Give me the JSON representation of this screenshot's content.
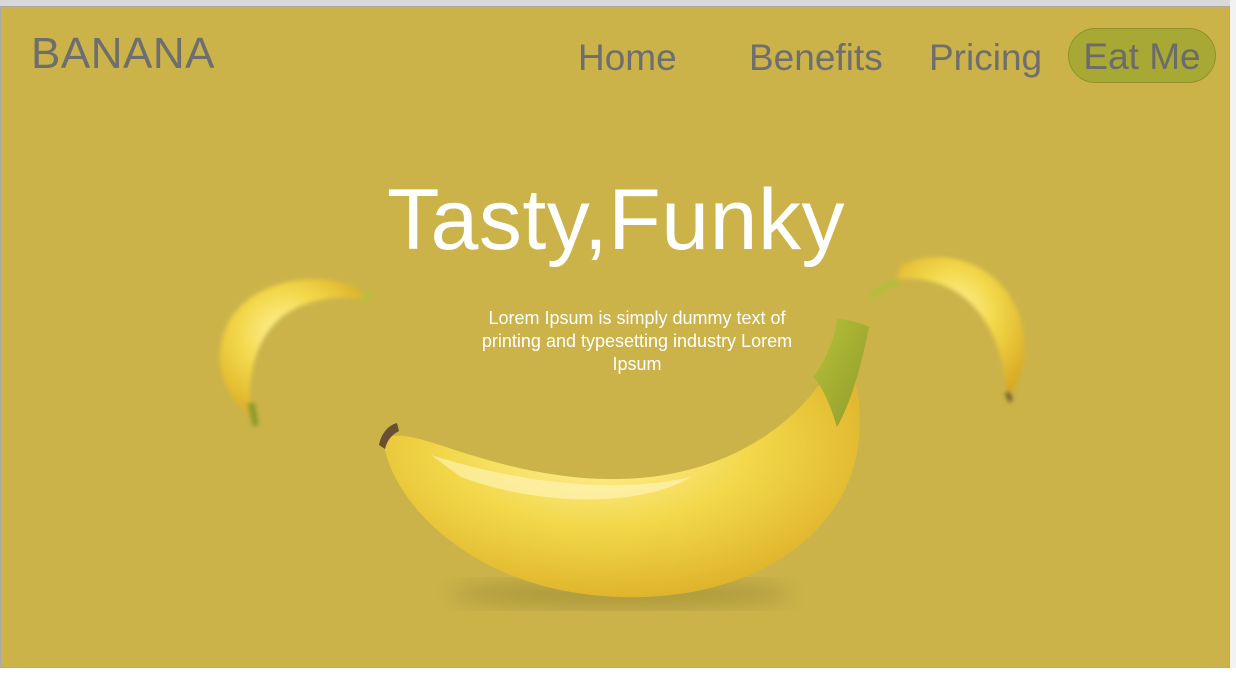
{
  "brand": {
    "name": "BANANA"
  },
  "nav": {
    "items": [
      {
        "label": "Home"
      },
      {
        "label": "Benefits"
      },
      {
        "label": "Pricing"
      }
    ],
    "cta_label": "Eat Me"
  },
  "hero": {
    "title": "Tasty,Funky",
    "description": "Lorem Ipsum is simply dummy text of printing and typesetting industry Lorem Ipsum"
  },
  "colors": {
    "background": "#cbb34a",
    "cta": "#a7a934",
    "nav_text": "#6e6e6e",
    "hero_text": "#ffffff"
  },
  "images": [
    "banana-hero-image",
    "banana-left-image",
    "banana-right-image"
  ]
}
